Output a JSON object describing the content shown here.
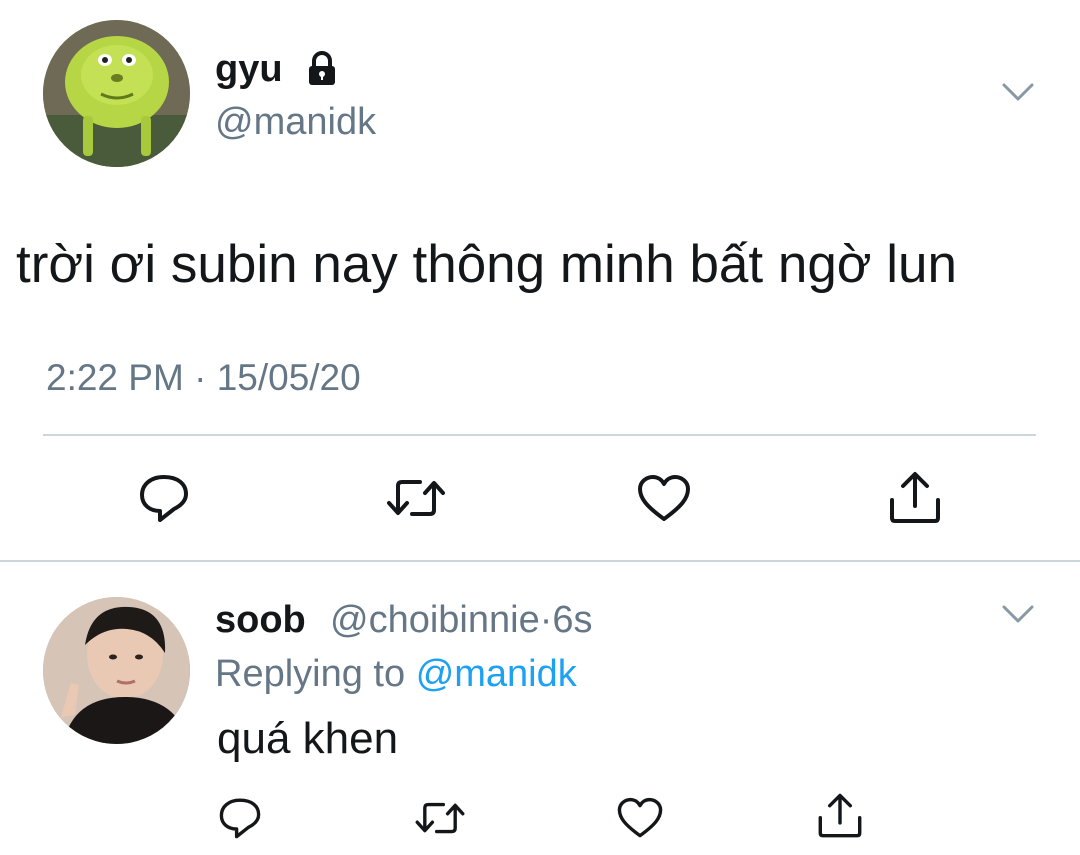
{
  "main_tweet": {
    "author": {
      "display_name": "gyu",
      "handle": "@manidk",
      "avatar_icon": "monster-face-avatar",
      "protected_icon": "lock-icon"
    },
    "text": "trời ơi subin nay thông minh bất ngờ lun",
    "time": "2:22 PM",
    "separator": "·",
    "date": "15/05/20",
    "actions": [
      {
        "name": "reply",
        "icon": "comment-icon"
      },
      {
        "name": "retweet",
        "icon": "retweet-icon"
      },
      {
        "name": "like",
        "icon": "heart-icon"
      },
      {
        "name": "share",
        "icon": "share-icon"
      }
    ],
    "menu_icon": "chevron-down-icon"
  },
  "reply_tweet": {
    "author": {
      "display_name": "soob",
      "handle": "@choibinnie",
      "avatar_icon": "person-photo-avatar"
    },
    "meta_separator": "·",
    "age": "6s",
    "replying_prefix": "Replying to",
    "replying_to": "@manidk",
    "text": "quá khen",
    "actions": [
      {
        "name": "reply",
        "icon": "comment-icon"
      },
      {
        "name": "retweet",
        "icon": "retweet-icon"
      },
      {
        "name": "like",
        "icon": "heart-icon"
      },
      {
        "name": "share",
        "icon": "share-icon"
      }
    ],
    "menu_icon": "chevron-down-icon"
  },
  "colors": {
    "text_primary": "#14171a",
    "text_secondary": "#657786",
    "link": "#1da1f2",
    "divider": "#ccd6dd"
  }
}
